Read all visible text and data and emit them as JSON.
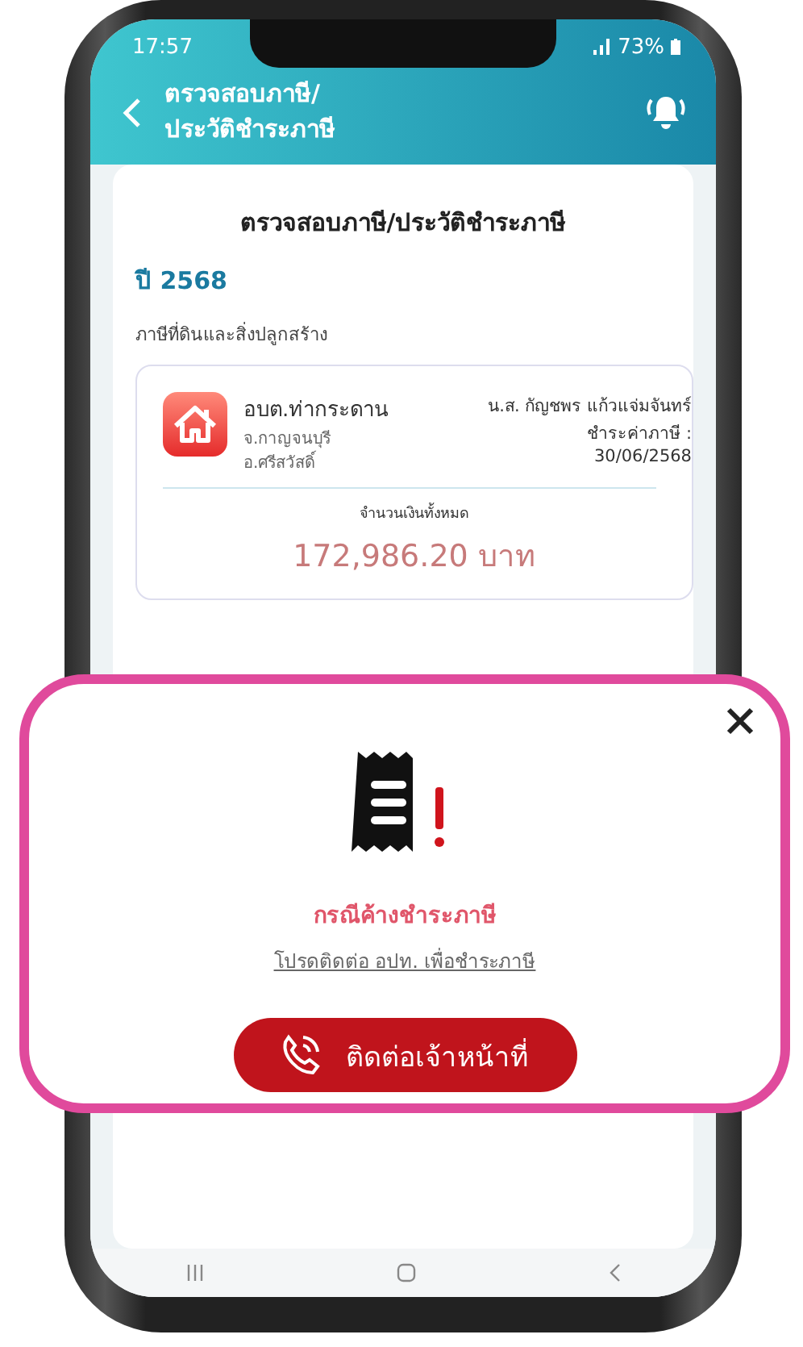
{
  "status_bar": {
    "time": "17:57",
    "battery": "73%"
  },
  "header": {
    "title": "ตรวจสอบภาษี/ประวัติชำระภาษี"
  },
  "card": {
    "title": "ตรวจสอบภาษี/ประวัติชำระภาษี",
    "year": "ปี 2568",
    "category": "ภาษีที่ดินและสิ่งปลูกสร้าง",
    "record": {
      "org": "อบต.ท่ากระดาน",
      "province": "จ.กาญจนบุรี",
      "district": "อ.ศรีสวัสดิ์",
      "owner": "น.ส. กัญชพร แก้วแจ่มจันทร์",
      "paid_label": "ชำระค่าภาษี :",
      "paid_date": "30/06/2568",
      "total_label": "จำนวนเงินทั้งหมด",
      "total": "172,986.20 บาท"
    }
  },
  "popup": {
    "title": "กรณีค้างชำระภาษี",
    "message": "โปรดติดต่อ อปท. เพื่อชำระภาษี",
    "button": "ติดต่อเจ้าหน้าที่"
  }
}
